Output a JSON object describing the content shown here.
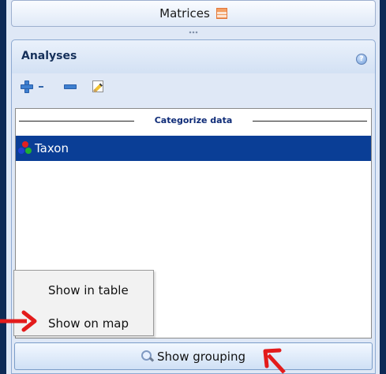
{
  "matrices": {
    "label": "Matrices",
    "icon": "table-icon"
  },
  "analyses": {
    "title": "Analyses",
    "help_icon": "help-icon",
    "toolbar": {
      "add_icon": "plus-icon",
      "dropdown_icon": "caret-icon",
      "remove_icon": "minus-icon",
      "edit_icon": "edit-icon"
    },
    "category_label": "Categorize data",
    "items": [
      {
        "label": "Taxon",
        "icon": "taxon-dots-icon",
        "selected": true
      }
    ],
    "grouping_button": "Show grouping"
  },
  "popup_menu": {
    "items": [
      "Show in table",
      "Show on map"
    ]
  },
  "colors": {
    "selection": "#0a3e96",
    "panel": "#dfe8f6",
    "annotation_arrow": "#e31b1b",
    "frame": "#0d2a56"
  }
}
